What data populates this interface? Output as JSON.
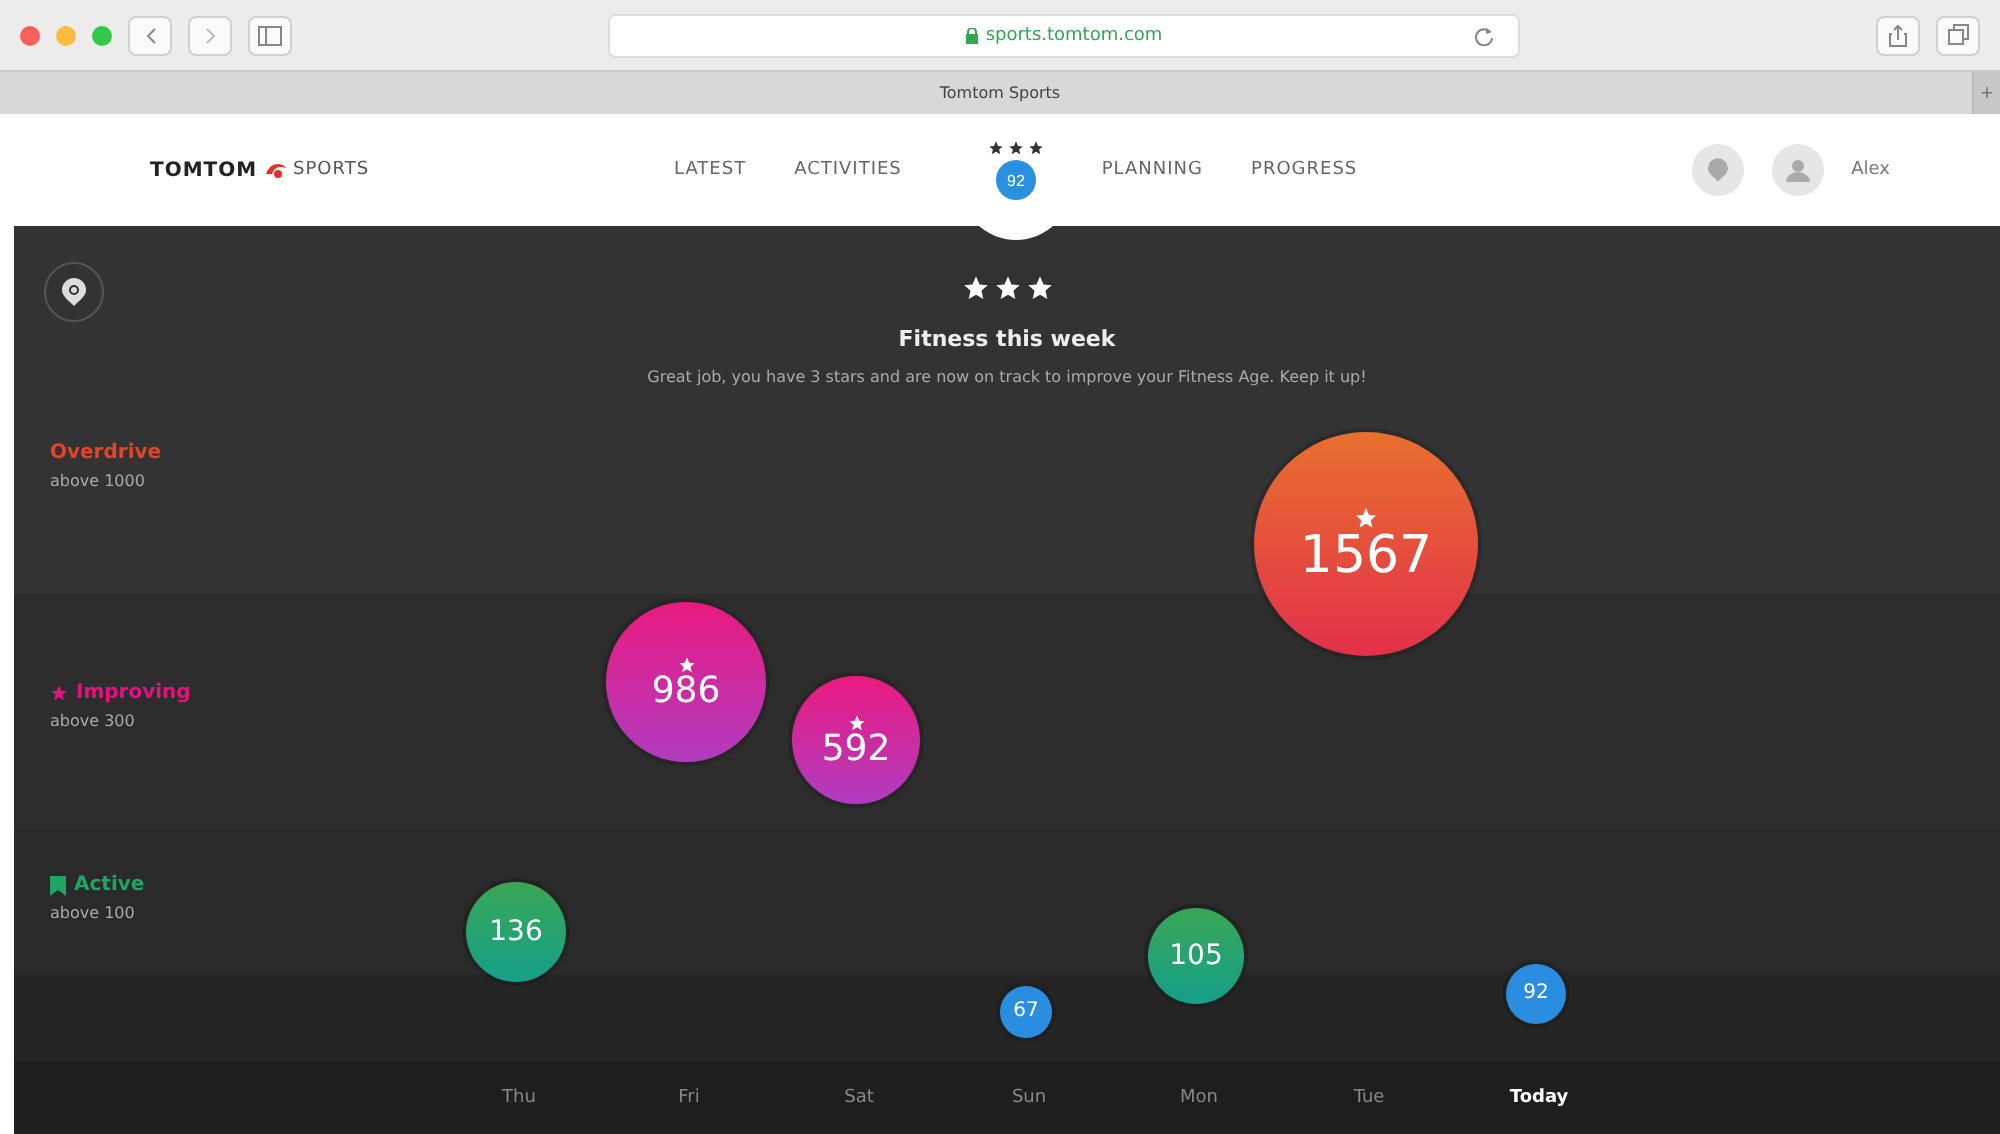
{
  "browser": {
    "url": "sports.tomtom.com",
    "tab_title": "Tomtom Sports",
    "new_tab": "+"
  },
  "nav": {
    "brand": "TOMTOM",
    "brand_suffix": "SPORTS",
    "links_left": [
      "LATEST",
      "ACTIVITIES"
    ],
    "badge": "92",
    "stars": 3,
    "links_right": [
      "PLANNING",
      "PROGRESS"
    ],
    "user": "Alex"
  },
  "summary": {
    "stars": 3,
    "title": "Fitness this week",
    "message": "Great job, you have 3 stars and are now on track to improve your Fitness Age. Keep it up!"
  },
  "zones": [
    {
      "kind": "overdrive",
      "name": "Overdrive",
      "threshold": "above 1000",
      "color": "#e2452b"
    },
    {
      "kind": "improving",
      "name": "Improving",
      "threshold": "above 300",
      "color": "#e5127d"
    },
    {
      "kind": "active",
      "name": "Active",
      "threshold": "above 100",
      "color": "#1fa463"
    }
  ],
  "days": [
    {
      "label": "Thu",
      "selected": false,
      "value": "136",
      "kind": "active",
      "star": false
    },
    {
      "label": "Fri",
      "selected": false,
      "value": "986",
      "kind": "improving",
      "star": true
    },
    {
      "label": "Sat",
      "selected": false,
      "value": "592",
      "kind": "improving",
      "star": true
    },
    {
      "label": "Sun",
      "selected": false,
      "value": "67",
      "kind": "base",
      "star": false
    },
    {
      "label": "Mon",
      "selected": false,
      "value": "105",
      "kind": "active",
      "star": false
    },
    {
      "label": "Tue",
      "selected": false,
      "value": "1567",
      "kind": "overdrive",
      "star": true
    },
    {
      "label": "Today",
      "selected": true,
      "value": "92",
      "kind": "base",
      "star": false
    }
  ]
}
